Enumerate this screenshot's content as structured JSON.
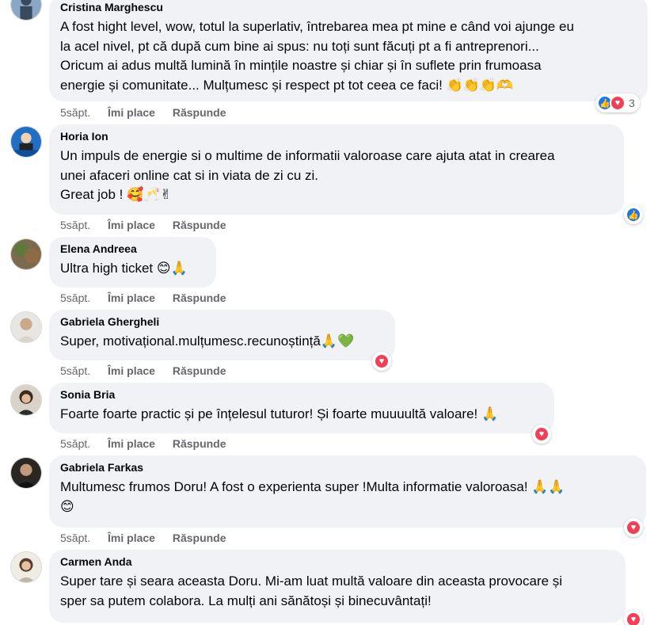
{
  "comments": [
    {
      "author": "Cristina Marghescu",
      "lines": [
        "A fost hight level, wow, totul la superlativ, întrebarea mea pt mine e când voi ajunge eu",
        "la acel nivel, pt că după cum bine ai spus: nu toți sunt făcuți pt a fi antreprenori...",
        "Oricum ai adus multă lumină în mințile noastre și chiar și în suflete prin frumoasa",
        "energie și comunitate... Mulțumesc și respect pt tot ceea ce faci! 👏👏👏🫶"
      ],
      "time": "5săpt.",
      "like_label": "Îmi place",
      "reply_label": "Răspunde",
      "reactions": [
        "like",
        "love"
      ],
      "reaction_count": "3"
    },
    {
      "author": "Horia Ion",
      "lines": [
        "Un impuls de energie si o multime de informatii valoroase care ajuta atat in crearea",
        "unei afaceri online cat si in viata de zi cu zi.",
        "Great job ! 🥰🥂✌"
      ],
      "time": "5săpt.",
      "like_label": "Îmi place",
      "reply_label": "Răspunde",
      "reactions": [
        "like"
      ]
    },
    {
      "author": "Elena Andreea",
      "lines": [
        "Ultra high ticket 😊🙏"
      ],
      "time": "5săpt.",
      "like_label": "Îmi place",
      "reply_label": "Răspunde",
      "reactions": []
    },
    {
      "author": "Gabriela Ghergheli",
      "lines": [
        "Super, motivațional.mulțumesc.recunoștință🙏💚"
      ],
      "time": "5săpt.",
      "like_label": "Îmi place",
      "reply_label": "Răspunde",
      "reactions": [
        "love"
      ]
    },
    {
      "author": "Sonia Bria",
      "lines": [
        "Foarte foarte practic și pe înțelesul tuturor! Și foarte muuuultă valoare! 🙏"
      ],
      "time": "5săpt.",
      "like_label": "Îmi place",
      "reply_label": "Răspunde",
      "reactions": [
        "love"
      ]
    },
    {
      "author": "Gabriela Farkas",
      "lines": [
        "Multumesc frumos Doru! A fost o experienta super !Multa informatie valoroasa! 🙏🙏",
        "😊"
      ],
      "time": "5săpt.",
      "like_label": "Îmi place",
      "reply_label": "Răspunde",
      "reactions": [
        "love"
      ]
    },
    {
      "author": "Carmen Anda",
      "lines": [
        "Super tare și seara aceasta Doru. Mi-am luat multă valoare din aceasta provocare și",
        "sper sa putem colabora. La mulți ani sănătoși și binecuvântați!"
      ],
      "time": "",
      "like_label": "",
      "reply_label": "",
      "reactions": [
        "love"
      ]
    }
  ],
  "colors": {
    "bubble": "#f0f2f5",
    "meta": "#65676b",
    "like_blue": "#1877f2",
    "love_red": "#f33e58"
  }
}
